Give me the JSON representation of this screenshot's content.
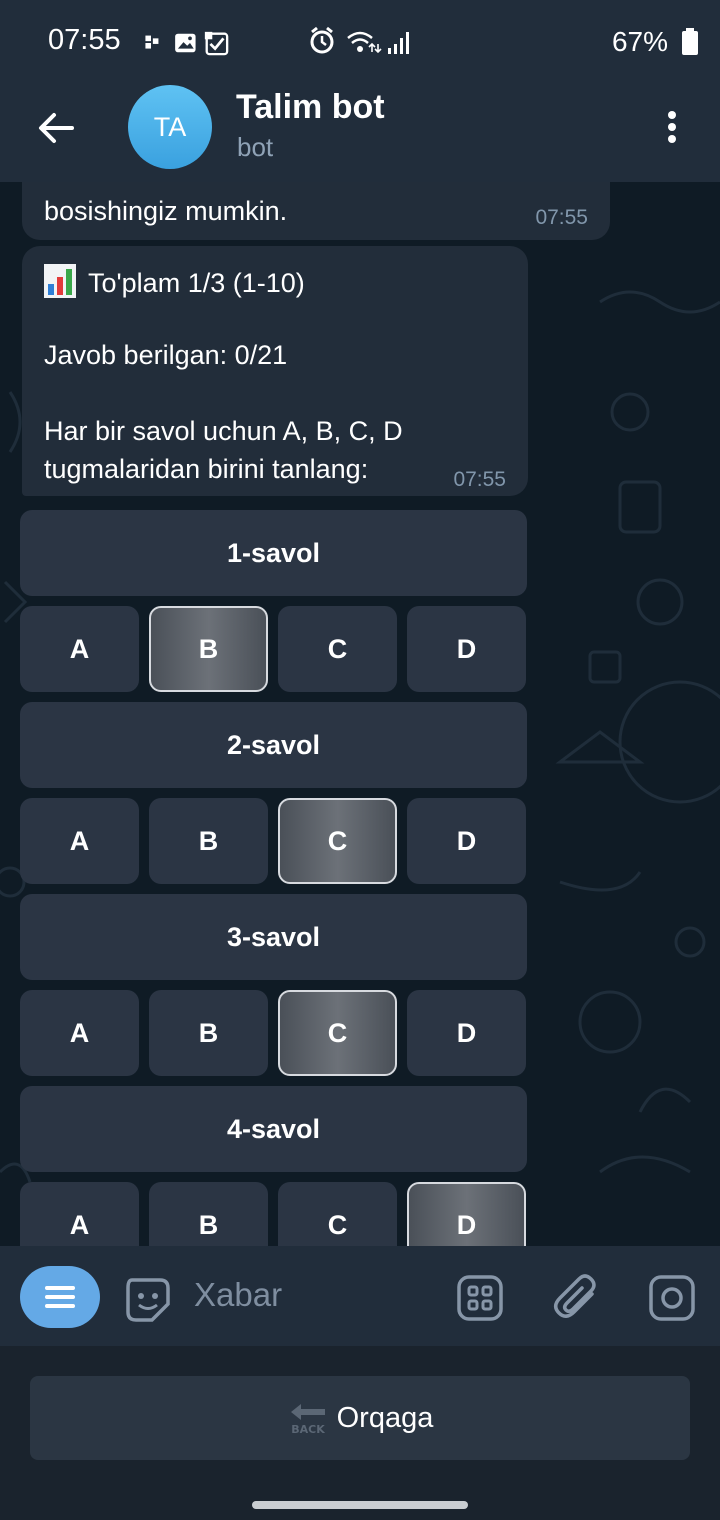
{
  "status_bar": {
    "time": "07:55",
    "battery": "67%",
    "icons": [
      "notification-dots-icon",
      "gallery-icon",
      "checkbox-notification-icon",
      "alarm-icon",
      "wifi-icon",
      "signal-icon",
      "battery-icon"
    ]
  },
  "header": {
    "avatar_initials": "TA",
    "title": "Talim bot",
    "subtitle": "bot"
  },
  "messages": [
    {
      "text": "bosishingiz mumkin.",
      "time": "07:55"
    },
    {
      "title": "To'plam 1/3 (1-10)",
      "answered": "Javob berilgan: 0/21",
      "instruction_line1": "Har bir savol uchun A, B, C, D",
      "instruction_line2": "tugmalaridan birini tanlang:",
      "time": "07:55"
    }
  ],
  "questions": [
    {
      "label": "1-savol",
      "options": [
        "A",
        "B",
        "C",
        "D"
      ],
      "selected": "B"
    },
    {
      "label": "2-savol",
      "options": [
        "A",
        "B",
        "C",
        "D"
      ],
      "selected": "C"
    },
    {
      "label": "3-savol",
      "options": [
        "A",
        "B",
        "C",
        "D"
      ],
      "selected": "C"
    },
    {
      "label": "4-savol",
      "options": [
        "A",
        "B",
        "C",
        "D"
      ],
      "selected": "D"
    }
  ],
  "input_bar": {
    "placeholder": "Xabar"
  },
  "reply_keyboard": {
    "back_label": "Orqaga",
    "back_emoji_text": "BACK"
  },
  "colors": {
    "header_bg": "#212d3b",
    "bubble_bg": "#222d3a",
    "button_bg": "#2b3544",
    "accent": "#64a9e6"
  }
}
